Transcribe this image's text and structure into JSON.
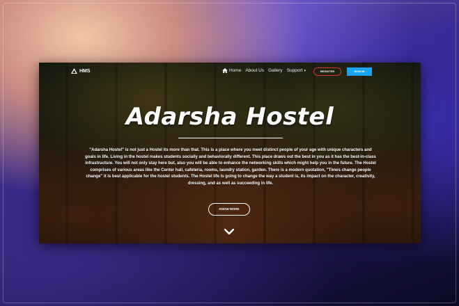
{
  "nav": {
    "logo_text": "HMS",
    "links": [
      "Home",
      "About Us",
      "Gallery",
      "Support"
    ],
    "register_label": "REGISTER",
    "signin_label": "SIGN IN"
  },
  "hero": {
    "title": "Adarsha Hostel",
    "description": "\"Adarsha Hostel\" is not just a Hostel its more than that. This is a place where you meet distinct people of your age with unique characters and goals in life. Living in the hostel makes students socially and behaviorally different. This place draws out the best in you as it has the best-in-class infrastructure. You will not only stay here but, also you will be able to enhance the networking skills which might help you in the future. The Hostel comprises of various areas like the Center hall, cafeteria, rooms, laundry station, garden. There is a modern quotation, \"Times change people change\" it is best applicable for the hostel students. The Hostel life is going to change the way a student is, its impact on the character, creativity, dressing, and as well as succeeding in life.",
    "know_more_label": "KNOW MORE"
  },
  "colors": {
    "register_border": "#d6362b",
    "signin_bg": "#1aa3f0"
  },
  "icons": [
    "logo-icon",
    "home-icon",
    "chevron-down-icon"
  ]
}
